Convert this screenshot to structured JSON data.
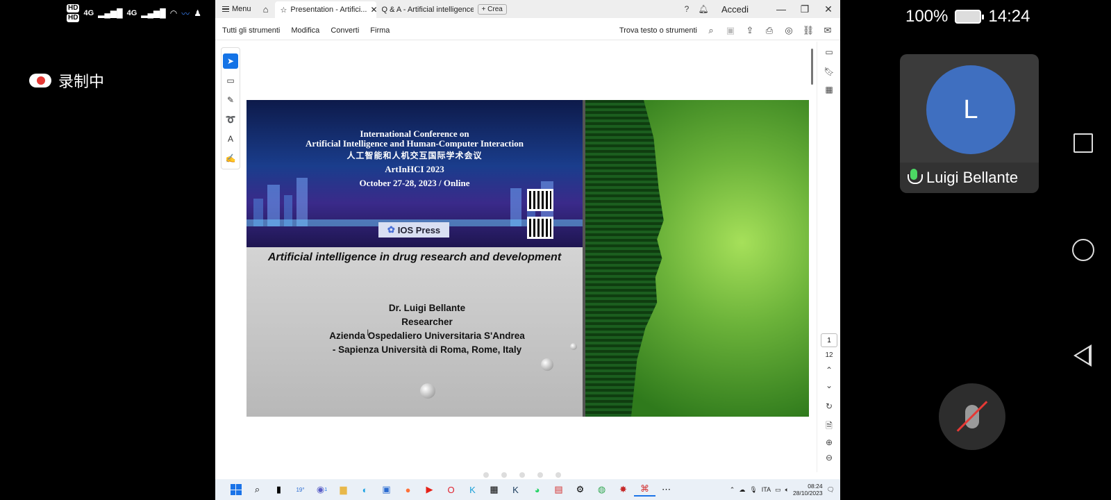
{
  "phone_status": {
    "hd1": "HD",
    "hd2": "HD",
    "sig1": "4G",
    "sig2": "4G",
    "recording_label": "录制中",
    "battery": "100%",
    "time": "14:24"
  },
  "participant": {
    "avatar_letter": "L",
    "name": "Luigi Bellante"
  },
  "browser": {
    "menu_label": "Menu",
    "tabs": [
      {
        "label": "Presentation - Artifici..."
      },
      {
        "label": "Q & A - Artificial intelligence..."
      }
    ],
    "new_tab_label": "Crea",
    "signin_label": "Accedi"
  },
  "toolbar": {
    "items": [
      "Tutti gli strumenti",
      "Modifica",
      "Converti",
      "Firma"
    ],
    "find_label": "Trova testo o strumenti"
  },
  "pager": {
    "current": "1",
    "total": "12"
  },
  "slide": {
    "conf_line1": "International Conference on",
    "conf_line2": "Artificial Intelligence and Human-Computer Interaction",
    "conf_chinese": "人工智能和人机交互国际学术会议",
    "conf_short": "ArtInHCI 2023",
    "conf_date": "October 27-28, 2023 / Online",
    "publisher": "IOS Press",
    "title": "Artificial intelligence in drug research and development",
    "author": "Dr. Luigi Bellante",
    "role": "Researcher",
    "affiliation1": "Azienda Ospedaliero Universitaria S'Andrea",
    "affiliation2": "- Sapienza Università di Roma, Rome, Italy"
  },
  "taskbar": {
    "weather": "19°",
    "chat_badge": "1",
    "lang": "ITA",
    "clock_time": "08:24",
    "clock_date": "28/10/2023"
  },
  "colors": {
    "accent": "#1473e6",
    "avatar": "#3f6fc0",
    "mute": "#e53935"
  }
}
